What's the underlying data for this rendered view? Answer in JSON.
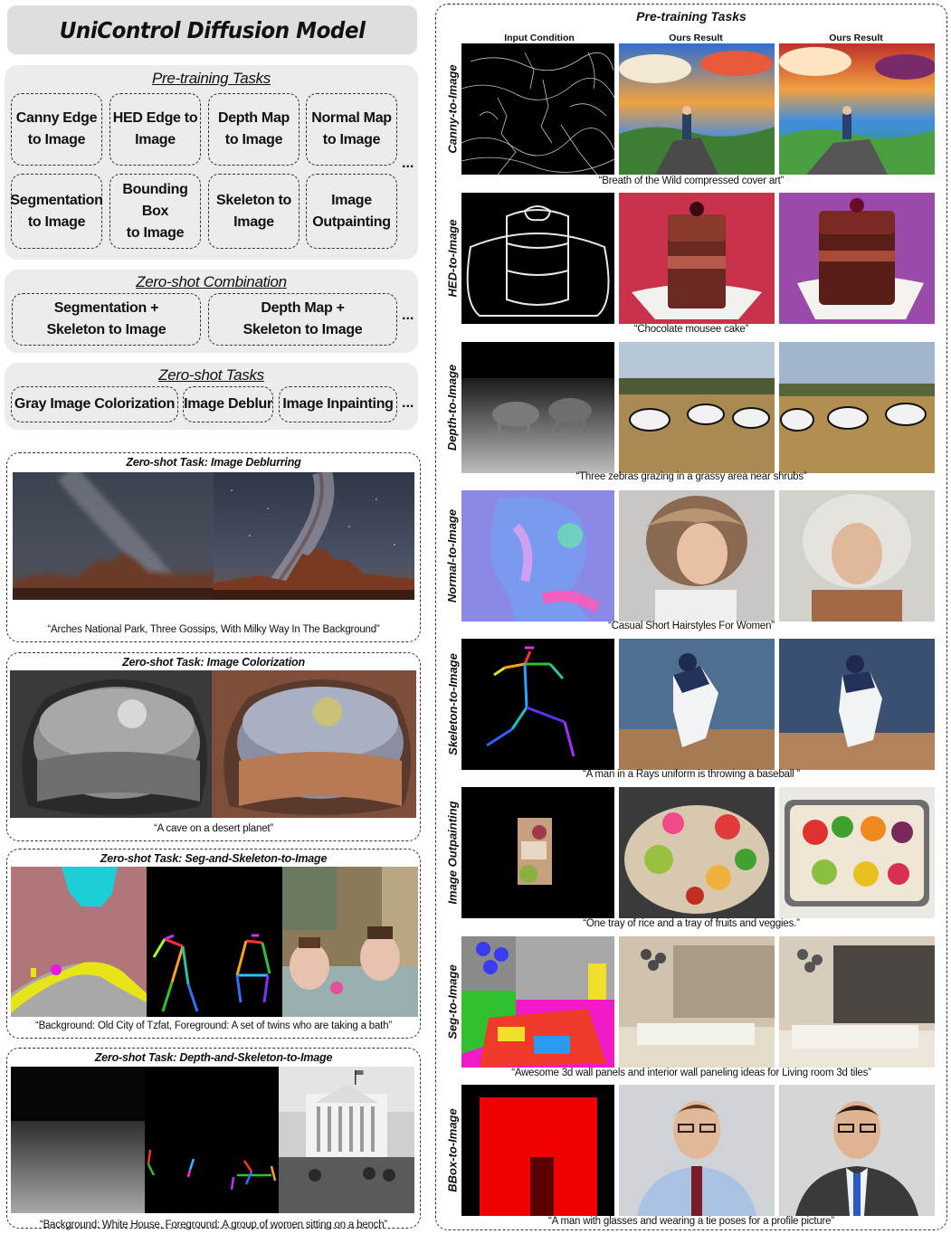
{
  "title": "UniControl Diffusion Model",
  "pretraining": {
    "title": "Pre-training Tasks",
    "tasks": [
      "Canny Edge\nto Image",
      "HED Edge to\nImage",
      "Depth Map\nto Image",
      "Normal Map\nto Image",
      "Segmentation\nto Image",
      "Bounding Box\nto Image",
      "Skeleton to\nImage",
      "Image\nOutpainting"
    ],
    "ellipsis": "..."
  },
  "zero_shot_combination": {
    "title": "Zero-shot Combination",
    "tasks": [
      "Segmentation +\nSkeleton to Image",
      "Depth Map +\nSkeleton to Image"
    ],
    "ellipsis": "..."
  },
  "zero_shot_tasks": {
    "title": "Zero-shot Tasks",
    "tasks": [
      "Gray Image Colorization",
      "Image Deblur",
      "Image Inpainting"
    ],
    "ellipsis": "..."
  },
  "examples_left": [
    {
      "title": "Zero-shot Task: Image Deblurring",
      "caption": "“Arches National Park, Three Gossips, With Milky Way In The Background”"
    },
    {
      "title": "Zero-shot Task: Image Colorization",
      "caption": "“A cave on a desert planet”"
    },
    {
      "title": "Zero-shot Task: Seg-and-Skeleton-to-Image",
      "caption": "“Background: Old City of Tzfat, Foreground: A set of twins who are taking a bath”"
    },
    {
      "title": "Zero-shot Task: Depth-and-Skeleton-to-Image",
      "caption": "“Background: White House, Foreground: A group of women sitting on a bench”"
    }
  ],
  "right_panel": {
    "title": "Pre-training Tasks",
    "columns": [
      "Input Condition",
      "Ours Result",
      "Ours Result"
    ],
    "rows": [
      {
        "label": "Canny-to-Image",
        "caption": "“Breath of the Wild compressed cover art”"
      },
      {
        "label": "HED-to-Image",
        "caption": "“Chocolate mousee cake”"
      },
      {
        "label": "Depth-to-Image",
        "caption": "“Three zebras grazing in a grassy area near shrubs”"
      },
      {
        "label": "Normal-to-Image",
        "caption": "“Casual Short Hairstyles For Women”"
      },
      {
        "label": "Skeleton-to-Image",
        "caption": "“A man in a Rays uniform is throwing a baseball ”"
      },
      {
        "label": "Image Outpainting",
        "caption": "“One tray of rice and a tray of fruits and veggies.”"
      },
      {
        "label": "Seg-to-Image",
        "caption": "“Awesome 3d wall panels and interior wall paneling ideas for Living room 3d tiles”"
      },
      {
        "label": "BBox-to-Image",
        "caption": "“A man with glasses and wearing a tie poses for a profile picture”"
      }
    ]
  }
}
